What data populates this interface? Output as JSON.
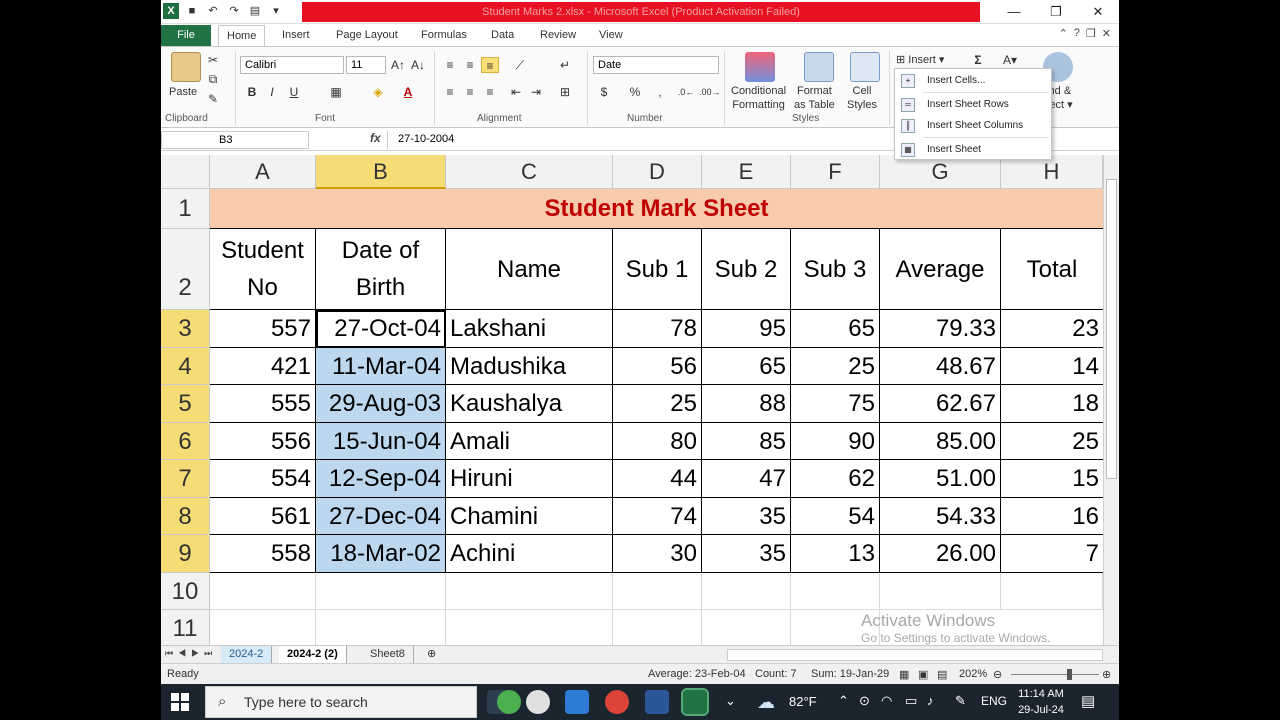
{
  "title_bar": {
    "title": "Student Marks 2.xlsx - Microsoft Excel (Product Activation Failed)",
    "app_logo": "X"
  },
  "ribbon_tabs": [
    "File",
    "Home",
    "Insert",
    "Page Layout",
    "Formulas",
    "Data",
    "Review",
    "View"
  ],
  "ribbon": {
    "font_name": "Calibri",
    "font_size": "11",
    "number_format": "Date",
    "paste_label": "Paste",
    "cond_format": "Conditional",
    "cond_format2": "Formatting",
    "format_table": "Format",
    "format_table2": "as Table",
    "cell_styles": "Cell",
    "cell_styles2": "Styles",
    "insert_label": "Insert",
    "find_select1": "nd &",
    "find_select2": "lect",
    "groups": {
      "clipboard": "Clipboard",
      "font": "Font",
      "alignment": "Alignment",
      "number": "Number",
      "styles": "Styles"
    },
    "icons": {
      "bold": "B",
      "italic": "I",
      "underline": "U",
      "currency": "$",
      "percent": "%",
      "sum": "Σ",
      "font_color": "A"
    }
  },
  "insert_menu": {
    "items": [
      "Insert Cells...",
      "Insert Sheet Rows",
      "Insert Sheet Columns",
      "Insert Sheet"
    ]
  },
  "formula_bar": {
    "name_box": "B3",
    "fx": "fx",
    "formula": "27-10-2004"
  },
  "columns": [
    "A",
    "B",
    "C",
    "D",
    "E",
    "F",
    "G",
    "H"
  ],
  "rows": [
    "1",
    "2",
    "3",
    "4",
    "5",
    "6",
    "7",
    "8",
    "9",
    "10",
    "11"
  ],
  "sheet": {
    "title": "Student Mark Sheet",
    "headers": {
      "student_no_1": "Student",
      "student_no_2": "No",
      "dob_1": "Date of",
      "dob_2": "Birth",
      "name": "Name",
      "sub1": "Sub 1",
      "sub2": "Sub 2",
      "sub3": "Sub 3",
      "average": "Average",
      "total": "Total"
    },
    "records": [
      {
        "no": "557",
        "dob": "27-Oct-04",
        "name": "Lakshani",
        "s1": "78",
        "s2": "95",
        "s3": "65",
        "avg": "79.33",
        "total": "23"
      },
      {
        "no": "421",
        "dob": "11-Mar-04",
        "name": "Madushika",
        "s1": "56",
        "s2": "65",
        "s3": "25",
        "avg": "48.67",
        "total": "14"
      },
      {
        "no": "555",
        "dob": "29-Aug-03",
        "name": "Kaushalya",
        "s1": "25",
        "s2": "88",
        "s3": "75",
        "avg": "62.67",
        "total": "18"
      },
      {
        "no": "556",
        "dob": "15-Jun-04",
        "name": "Amali",
        "s1": "80",
        "s2": "85",
        "s3": "90",
        "avg": "85.00",
        "total": "25"
      },
      {
        "no": "554",
        "dob": "12-Sep-04",
        "name": "Hiruni",
        "s1": "44",
        "s2": "47",
        "s3": "62",
        "avg": "51.00",
        "total": "15"
      },
      {
        "no": "561",
        "dob": "27-Dec-04",
        "name": "Chamini",
        "s1": "74",
        "s2": "35",
        "s3": "54",
        "avg": "54.33",
        "total": "16"
      },
      {
        "no": "558",
        "dob": "18-Mar-02",
        "name": "Achini",
        "s1": "30",
        "s2": "35",
        "s3": "13",
        "avg": "26.00",
        "total": "7"
      }
    ]
  },
  "watermark": {
    "line1": "Activate Windows",
    "line2": "Go to Settings to activate Windows."
  },
  "sheet_tabs": [
    "2024-2",
    "2024-2  (2)",
    "Sheet8"
  ],
  "status_bar": {
    "ready": "Ready",
    "average": "Average: 23-Feb-04",
    "count": "Count: 7",
    "sum": "Sum: 19-Jan-29",
    "zoom": "202%"
  },
  "taskbar": {
    "search_placeholder": "Type here to search",
    "weather": "82°F",
    "language": "ENG",
    "time": "11:14 AM",
    "date": "29-Jul-24"
  },
  "colors": {
    "title_fill": "#f8cbad",
    "title_text": "#c00000",
    "selected_fill": "#bdd7ee",
    "header_highlight": "#f6dc75",
    "excel_green": "#217346"
  }
}
